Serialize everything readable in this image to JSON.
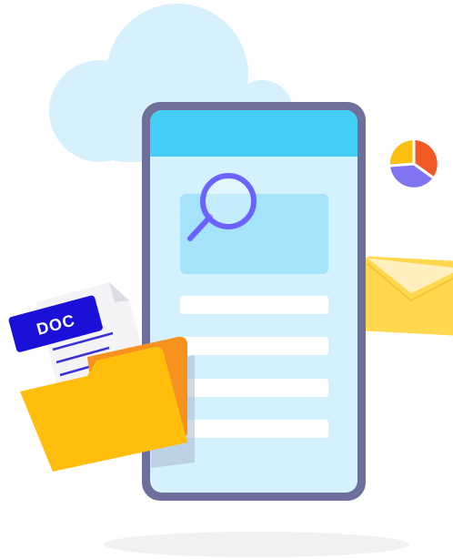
{
  "illustration": {
    "doc_badge_text": "DOC",
    "icons": {
      "cloud": "cloud-icon",
      "phone": "smartphone-icon",
      "search": "magnifier-icon",
      "pie": "pie-chart-icon",
      "envelope": "envelope-icon",
      "document": "document-icon",
      "folder": "folder-icon"
    },
    "colors": {
      "cloud": "#d6f1fb",
      "phone_frame": "#6f6f9c",
      "phone_screen": "#d3f2fd",
      "phone_header": "#44cdf5",
      "search_panel": "#a5e3fa",
      "magnifier": "#6c63ff",
      "doc_badge": "#1a10d8",
      "folder_front": "#ffbe0b",
      "folder_back": "#f7921e",
      "envelope": "#ffd84d",
      "pie_orange": "#f15a24",
      "pie_yellow": "#fbbf0f",
      "pie_purple": "#7f75f0"
    }
  }
}
